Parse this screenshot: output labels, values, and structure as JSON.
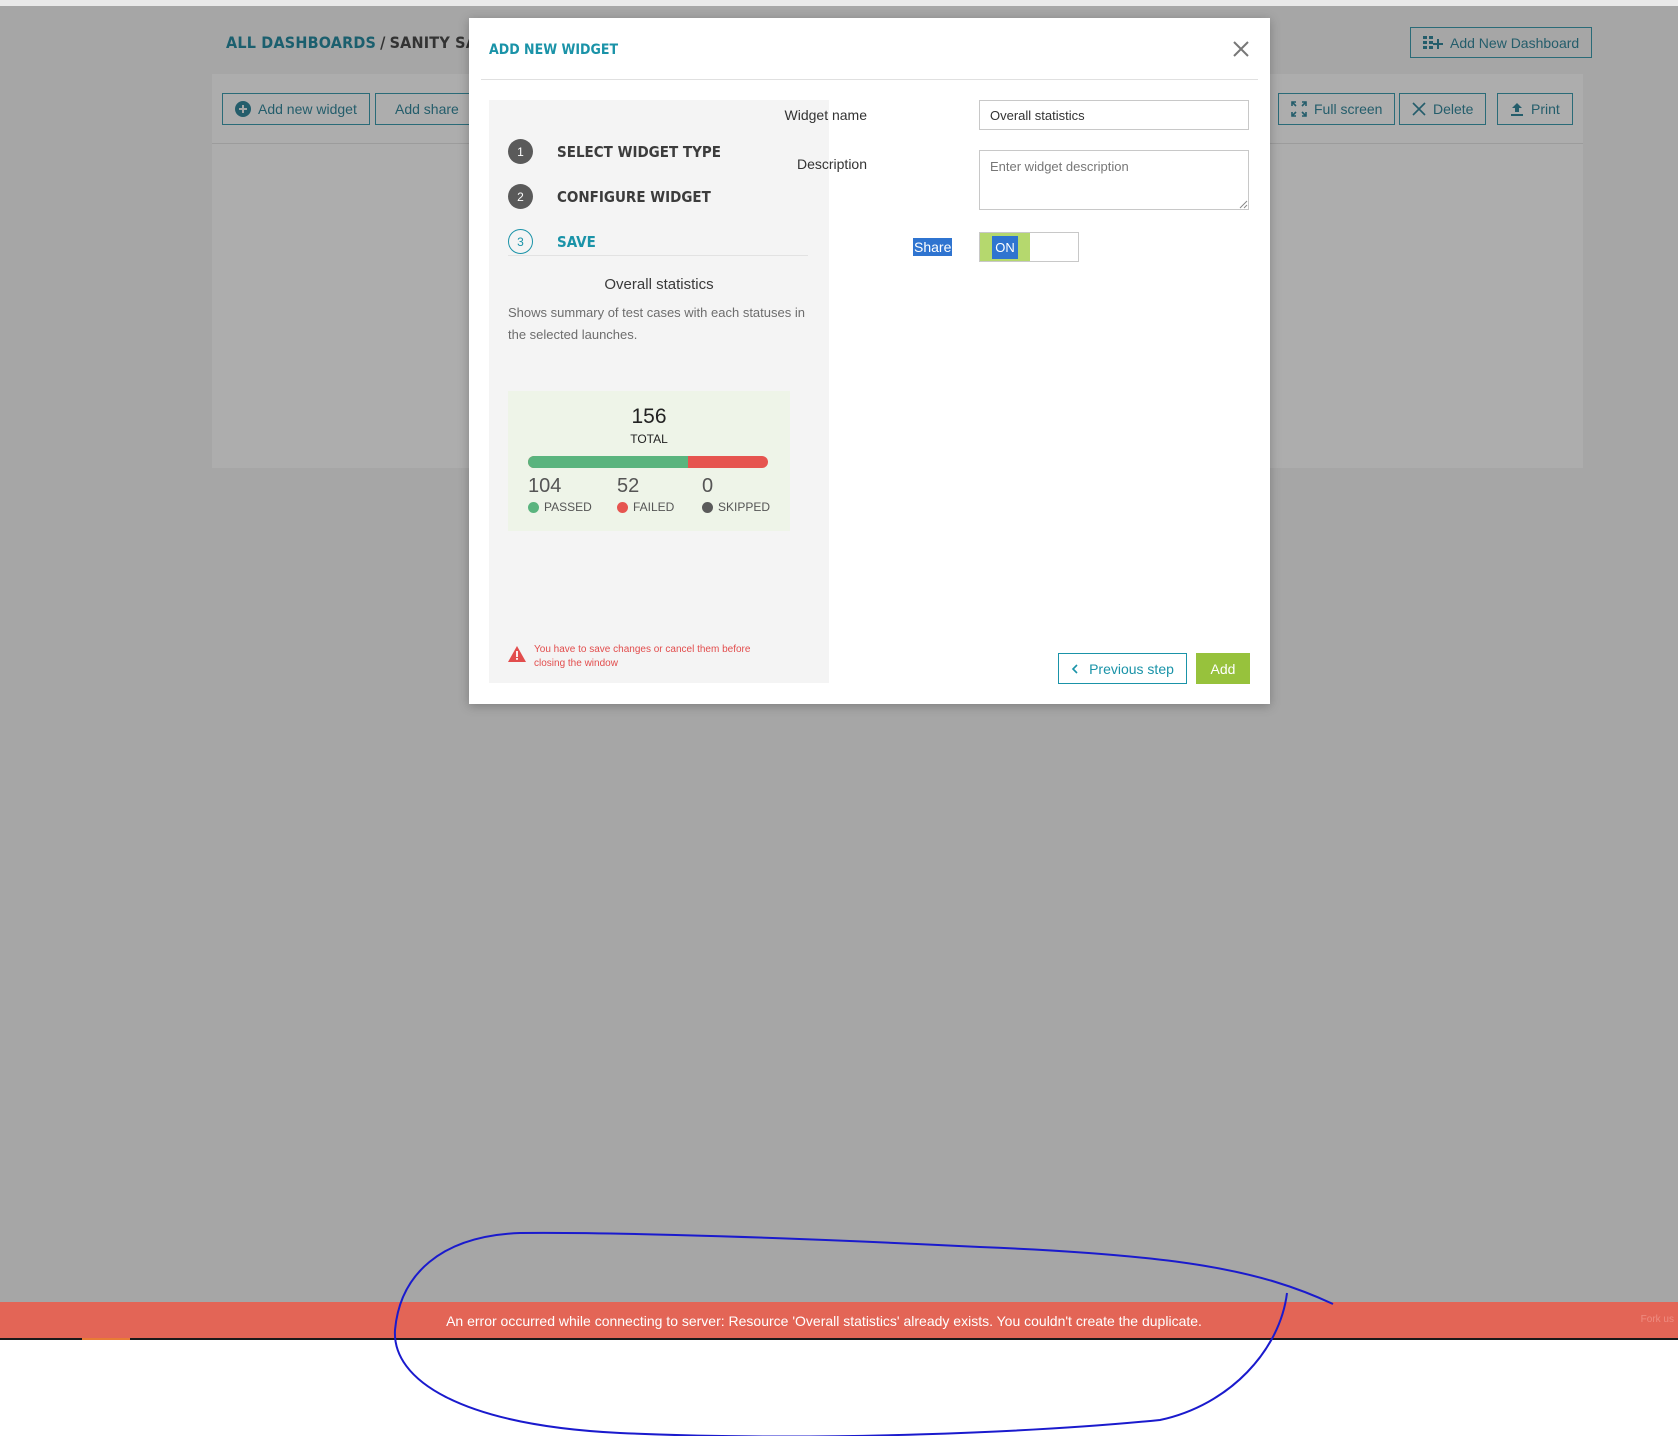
{
  "header": {
    "breadcrumb_link": "ALL DASHBOARDS",
    "breadcrumb_separator": "/",
    "breadcrumb_current": "SANITY SAMPLE"
  },
  "toolbar": {
    "add_new_widget": "Add new widget",
    "add_shared": "Add share",
    "full_screen": "Full screen",
    "delete": "Delete",
    "print": "Print",
    "add_new_dashboard": "Add New Dashboard"
  },
  "modal": {
    "title": "ADD NEW WIDGET",
    "steps": [
      {
        "number": "1",
        "label": "SELECT WIDGET TYPE"
      },
      {
        "number": "2",
        "label": "CONFIGURE WIDGET"
      },
      {
        "number": "3",
        "label": "SAVE"
      }
    ],
    "preview": {
      "title": "Overall statistics",
      "description": "Shows summary of test cases with each statuses in the selected launches.",
      "total": "156",
      "total_label": "TOTAL",
      "passed_fraction": 0.667,
      "stats": [
        {
          "value": "104",
          "label": "PASSED",
          "color": "#5ab47e"
        },
        {
          "value": "52",
          "label": "FAILED",
          "color": "#e6544f"
        },
        {
          "value": "0",
          "label": "SKIPPED",
          "color": "#5a5a5a"
        }
      ]
    },
    "warning": "You have to save changes or cancel them before closing the window",
    "form": {
      "widget_name_label": "Widget name",
      "widget_name_value": "Overall statistics",
      "description_label": "Description",
      "description_placeholder": "Enter widget description",
      "share_label": "Share",
      "share_state": "ON"
    },
    "buttons": {
      "previous": "Previous step",
      "add": "Add"
    }
  },
  "error_banner": {
    "message": "An error occurred while connecting to server: Resource 'Overall statistics' already exists. You couldn't create the duplicate.",
    "right_text": "Fork us"
  },
  "colors": {
    "accent": "#1a93a8",
    "add_button": "#97c23c",
    "error_banner": "#e36556",
    "annotation": "#1a1acd"
  }
}
